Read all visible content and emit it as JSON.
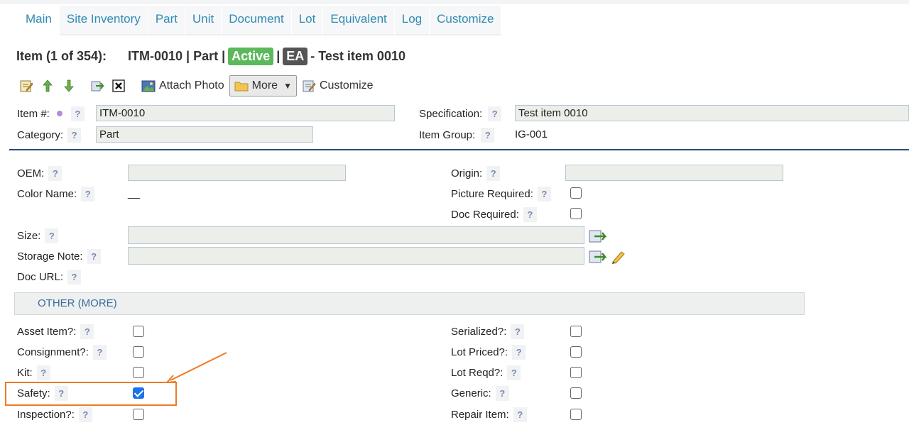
{
  "tabs": [
    "Main",
    "Site Inventory",
    "Part",
    "Unit",
    "Document",
    "Lot",
    "Equivalent",
    "Log",
    "Customize"
  ],
  "title": {
    "count": "Item (1 of 354):",
    "code": "ITM-0010 | Part |",
    "status": "Active",
    "sep": "|",
    "uom": "EA",
    "desc": "- Test item 0010"
  },
  "toolbar": {
    "attach_photo": "Attach Photo",
    "more": "More",
    "customize": "Customize"
  },
  "header": {
    "item_label": "Item #:",
    "item_value": "ITM-0010",
    "spec_label": "Specification:",
    "spec_value": "Test item 0010",
    "category_label": "Category:",
    "category_value": "Part",
    "group_label": "Item Group:",
    "group_value": "IG-001"
  },
  "fields": {
    "oem": "OEM:",
    "origin": "Origin:",
    "color_name": "Color Name:",
    "color_value": "__",
    "picture_required": "Picture Required:",
    "doc_required": "Doc Required:",
    "size": "Size:",
    "storage_note": "Storage Note:",
    "doc_url": "Doc URL:"
  },
  "section": "OTHER (MORE)",
  "checks_left": [
    {
      "label": "Asset Item?:",
      "checked": false
    },
    {
      "label": "Consignment?:",
      "checked": false
    },
    {
      "label": "Kit:",
      "checked": false
    },
    {
      "label": "Safety:",
      "checked": true
    },
    {
      "label": "Inspection?:",
      "checked": false
    }
  ],
  "checks_right": [
    {
      "label": "Serialized?:",
      "checked": false
    },
    {
      "label": "Lot Priced?:",
      "checked": false
    },
    {
      "label": "Lot Reqd?:",
      "checked": false
    },
    {
      "label": "Generic:",
      "checked": false
    },
    {
      "label": "Repair Item:",
      "checked": false
    }
  ],
  "help_glyph": "?",
  "colors": {
    "tab_text": "#2f8ab3",
    "active_badge": "#5cb85c",
    "uom_badge": "#555555",
    "divider": "#2a4a7a",
    "highlight": "#f07a23",
    "checkbox_checked": "#1a73e8"
  }
}
